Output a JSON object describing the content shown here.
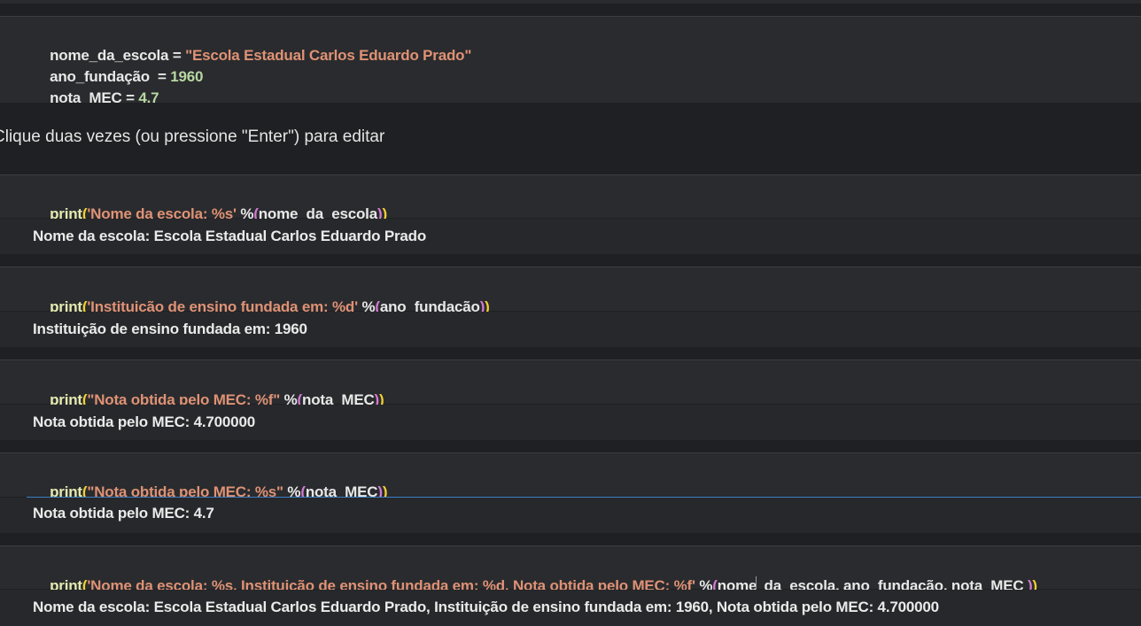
{
  "cells": {
    "vars": {
      "line1": {
        "name": "nome_da_escola",
        "eq": " = ",
        "value": "\"Escola Estadual Carlos Eduardo Prado\""
      },
      "line2": {
        "name": "ano_fundação ",
        "eq": " = ",
        "value": "1960"
      },
      "line3": {
        "name": "nota_MEC",
        "eq": " = ",
        "value": "4.7"
      }
    },
    "text_cell": {
      "text": "Clique duas vezes (ou pressione \"Enter\") para editar"
    },
    "c1": {
      "fn": "print",
      "open": "(",
      "str": "'Nome da escola: %s'",
      "op": " %",
      "open2": "(",
      "arg": "nome_da_escola",
      "close2": ")",
      "close": ")",
      "output": "Nome da escola: Escola Estadual Carlos Eduardo Prado"
    },
    "c2": {
      "fn": "print",
      "open": "(",
      "str": "'Instituição de ensino fundada em: %d'",
      "op": " %",
      "open2": "(",
      "arg": "ano_fundação",
      "close2": ")",
      "close": ")",
      "output": "Instituição de ensino fundada em: 1960"
    },
    "c3": {
      "fn": "print",
      "open": "(",
      "str": "\"Nota obtida pelo MEC: %f\"",
      "op": " %",
      "open2": "(",
      "arg": "nota_MEC",
      "close2": ")",
      "close": ")",
      "output": "Nota obtida pelo MEC: 4.700000"
    },
    "c4": {
      "fn": "print",
      "open": "(",
      "str": "\"Nota obtida pelo MEC: %s\"",
      "op": " %",
      "open2": "(",
      "arg": "nota_MEC",
      "close2": ")",
      "close": ")",
      "output": "Nota obtida pelo MEC: 4.7"
    },
    "c5": {
      "fn": "print",
      "open": "(",
      "str": "'Nome da escola: %s, Instituição de ensino fundada em: %d, Nota obtida pelo MEC: %f'",
      "op": " %",
      "open2": "(",
      "arg_a": "nome",
      "arg_b": "_da_escola, ano_fundação, nota_MEC ",
      "close2": ")",
      "close": ")",
      "output": "Nome da escola: Escola Estadual Carlos Eduardo Prado, Instituição de ensino fundada em: 1960, Nota obtida pelo MEC: 4.700000"
    }
  }
}
